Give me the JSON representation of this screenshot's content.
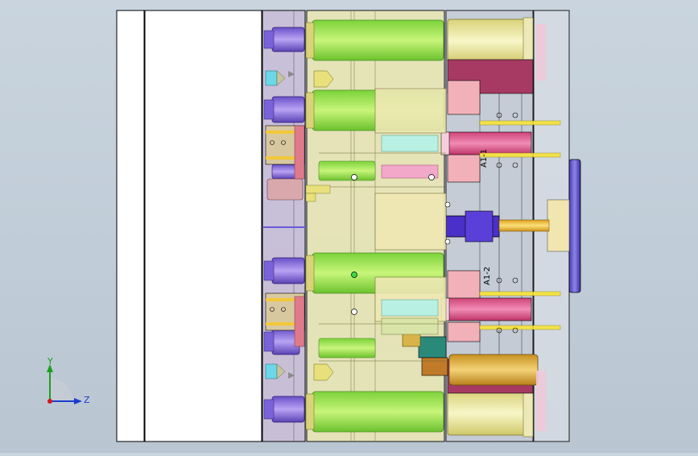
{
  "viewport": {
    "background_top": "#c9d4de",
    "background_bottom": "#b9c6d2"
  },
  "annotations": {
    "label_top": "A1-1",
    "label_bottom": "A1-2"
  },
  "triad": {
    "y_label": "Y",
    "z_label": "Z",
    "y_color": "#1aa01a",
    "z_color": "#1a3cd0",
    "x_color": "#d01a1a"
  },
  "colors": {
    "plate_outline": "#000000",
    "guide_pillar_green": "#9be64a",
    "bushing_yellow": "#f2f0a0",
    "pink": "#e85d8c",
    "purple": "#8a6ee0",
    "gold": "#e8b84a",
    "sprue_purple": "#6a5cd0"
  }
}
